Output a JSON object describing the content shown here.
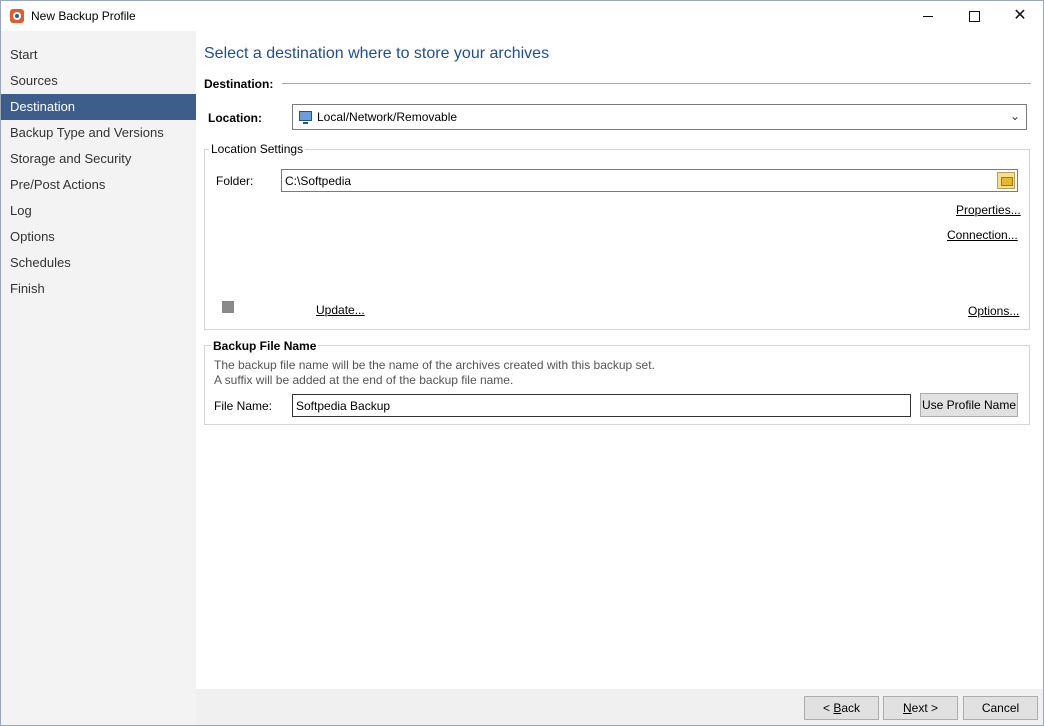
{
  "window": {
    "title": "New Backup Profile"
  },
  "sidebar": {
    "items": [
      {
        "label": "Start",
        "active": false
      },
      {
        "label": "Sources",
        "active": false
      },
      {
        "label": "Destination",
        "active": true
      },
      {
        "label": "Backup Type and Versions",
        "active": false
      },
      {
        "label": "Storage and Security",
        "active": false
      },
      {
        "label": "Pre/Post Actions",
        "active": false
      },
      {
        "label": "Log",
        "active": false
      },
      {
        "label": "Options",
        "active": false
      },
      {
        "label": "Schedules",
        "active": false
      },
      {
        "label": "Finish",
        "active": false
      }
    ]
  },
  "main": {
    "heading": "Select a destination where to store your archives",
    "destination_label": "Destination:",
    "location": {
      "label": "Location:",
      "value": "Local/Network/Removable",
      "icon": "monitor-icon"
    },
    "location_settings": {
      "title": "Location Settings",
      "folder_label": "Folder:",
      "folder_value": "C:\\Softpedia",
      "properties_link": "Properties...",
      "connection_link": "Connection...",
      "update_link": "Update...",
      "options_link": "Options..."
    },
    "backup_file": {
      "title": "Backup File Name",
      "desc1": "The backup file name will be the name of the archives created with this backup set.",
      "desc2": "A suffix will be added at the end of the backup file name.",
      "file_name_label": "File Name:",
      "file_name_value": "Softpedia Backup",
      "use_profile_button": "Use Profile Name"
    }
  },
  "footer": {
    "back_prefix": "< ",
    "back_accel": "B",
    "back_rest": "ack",
    "next_accel": "N",
    "next_rest": "ext >",
    "cancel": "Cancel"
  },
  "colors": {
    "accent": "#3d5d8a",
    "heading": "#1f4e99"
  }
}
